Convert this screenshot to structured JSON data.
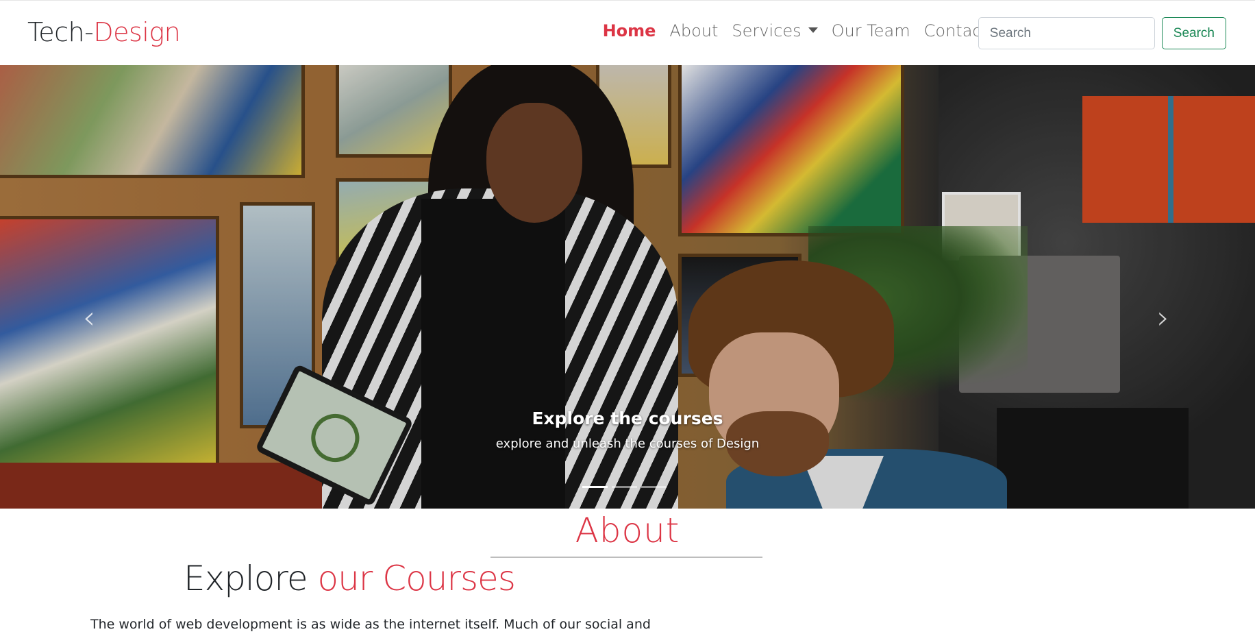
{
  "brand": {
    "prefix": "Tech-",
    "accent": "Design"
  },
  "nav": {
    "items": [
      {
        "label": "Home",
        "active": true
      },
      {
        "label": "About"
      },
      {
        "label": "Services",
        "dropdown": true
      },
      {
        "label": "Our Team"
      },
      {
        "label": "Contact"
      }
    ]
  },
  "search": {
    "placeholder": "Search",
    "button_label": "Search"
  },
  "carousel": {
    "prev_icon": "‹",
    "next_icon": "›",
    "slide": {
      "title": "Explore the courses",
      "subtitle": "explore and unleash the courses of Design"
    },
    "indicators": {
      "count": 3,
      "active_index": 0
    }
  },
  "about": {
    "heading": "About",
    "subheading_prefix": "Explore",
    "subheading_accent": "our Courses",
    "paragraph": "The world of web development is as wide as the internet itself. Much of our social and"
  },
  "colors": {
    "accent": "#dc3545",
    "success": "#198754"
  }
}
